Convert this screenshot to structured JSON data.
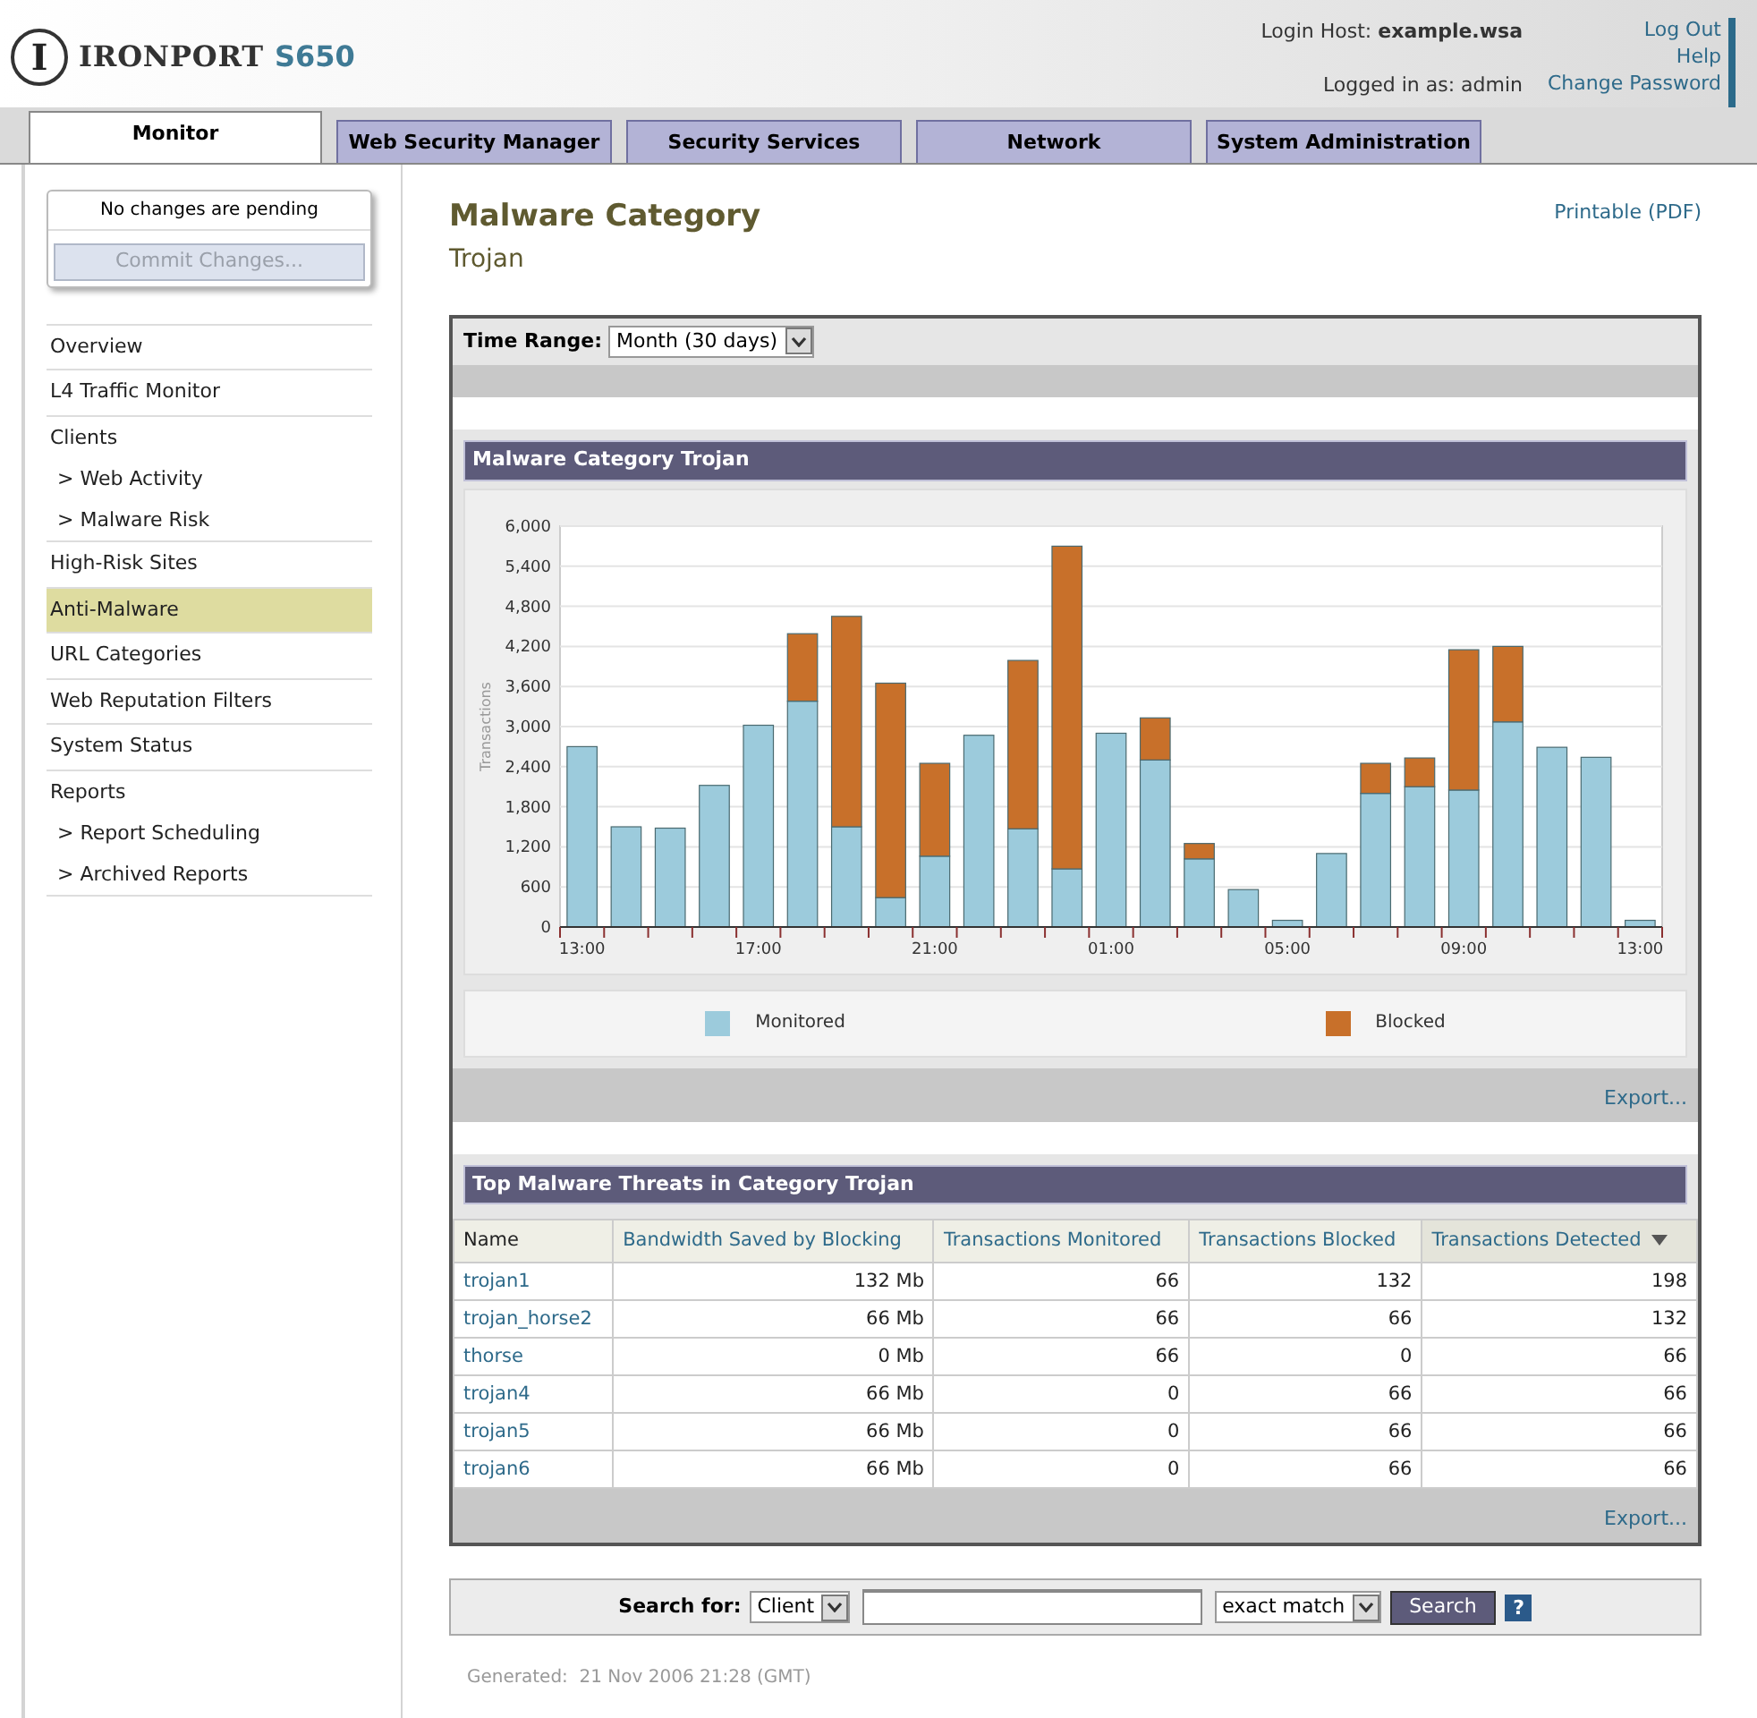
{
  "header": {
    "logo_mark": "I",
    "brand": "IRONPORT",
    "model": "S650",
    "login_host_label": "Login Host:",
    "login_host": "example.wsa",
    "logged_in": "Logged in as: admin",
    "links": [
      "Log Out",
      "Help",
      "Change Password"
    ]
  },
  "tabs": [
    {
      "label": "Monitor",
      "selected": true
    },
    {
      "label": "Web Security Manager",
      "selected": false
    },
    {
      "label": "Security Services",
      "selected": false
    },
    {
      "label": "Network",
      "selected": false
    },
    {
      "label": "System Administration",
      "selected": false
    }
  ],
  "sidebar": {
    "pending": {
      "status": "No changes are pending",
      "button": "Commit Changes...",
      "disabled": true
    },
    "items": [
      {
        "label": "Overview",
        "selected": false
      },
      {
        "label": "L4 Traffic Monitor",
        "selected": false
      },
      {
        "label": "Clients",
        "selected": false,
        "children": [
          {
            "label": "> Web Activity",
            "selected": false
          },
          {
            "label": "> Malware Risk",
            "selected": false
          }
        ]
      },
      {
        "label": "High-Risk Sites",
        "selected": false
      },
      {
        "label": "Anti-Malware",
        "selected": true
      },
      {
        "label": "URL Categories",
        "selected": false
      },
      {
        "label": "Web Reputation Filters",
        "selected": false
      },
      {
        "label": "System Status",
        "selected": false
      },
      {
        "label": "Reports",
        "selected": false,
        "children": [
          {
            "label": "> Report Scheduling",
            "selected": false
          },
          {
            "label": "> Archived Reports",
            "selected": false
          }
        ]
      }
    ]
  },
  "page": {
    "title": "Malware Category",
    "subtitle": "Trojan",
    "printable": "Printable (PDF)"
  },
  "time_range": {
    "label": "Time Range:",
    "value": "Month (30 days)"
  },
  "chart_panel": {
    "title": "Malware Category Trojan",
    "export": "Export...",
    "chart_data": {
      "type": "bar",
      "stacked": true,
      "grid": true,
      "ylabel": "Transactions",
      "categories": [
        "13:00",
        null,
        null,
        null,
        "17:00",
        null,
        null,
        null,
        "21:00",
        null,
        null,
        null,
        "01:00",
        null,
        null,
        null,
        "05:00",
        null,
        null,
        null,
        "09:00",
        null,
        null,
        null,
        "13:00"
      ],
      "ylim": [
        0,
        6000
      ],
      "yticks": [
        {
          "value": 0,
          "label": "0"
        },
        {
          "value": 600,
          "label": "600"
        },
        {
          "value": 1200,
          "label": "1,200"
        },
        {
          "value": 1800,
          "label": "1,800"
        },
        {
          "value": 2400,
          "label": "2,400"
        },
        {
          "value": 3000,
          "label": "3,000"
        },
        {
          "value": 3600,
          "label": "3,600"
        },
        {
          "value": 4200,
          "label": "4,200"
        },
        {
          "value": 4800,
          "label": "4,800"
        },
        {
          "value": 5400,
          "label": "5,400"
        },
        {
          "value": 6000,
          "label": "6,000"
        }
      ],
      "series": [
        {
          "name": "Monitored",
          "color": "#9ccbdc",
          "values": [
            2700,
            1500,
            1480,
            2120,
            3020,
            3380,
            1500,
            440,
            1060,
            2870,
            1470,
            870,
            2900,
            2500,
            1020,
            560,
            100,
            1100,
            2000,
            2100,
            2050,
            3070,
            2690,
            2540,
            100
          ]
        },
        {
          "name": "Blocked",
          "color": "#c8702a",
          "values": [
            0,
            0,
            0,
            0,
            0,
            1010,
            3150,
            3210,
            1390,
            0,
            2520,
            4830,
            0,
            630,
            230,
            0,
            0,
            0,
            450,
            430,
            2100,
            1130,
            0,
            0,
            0
          ]
        }
      ]
    }
  },
  "table": {
    "title": "Top Malware Threats in Category Trojan",
    "export": "Export...",
    "columns": [
      {
        "label": "Name",
        "sorted": false
      },
      {
        "label": "Bandwidth Saved by Blocking",
        "sorted": false
      },
      {
        "label": "Transactions Monitored",
        "sorted": false
      },
      {
        "label": "Transactions Blocked",
        "sorted": false
      },
      {
        "label": "Transactions Detected",
        "sorted": true
      }
    ],
    "rows": [
      [
        "trojan1",
        "132 Mb",
        "66",
        "132",
        "198"
      ],
      [
        "trojan_horse2",
        "66 Mb",
        "66",
        "66",
        "132"
      ],
      [
        "thorse",
        "0 Mb",
        "66",
        "0",
        "66"
      ],
      [
        "trojan4",
        "66 Mb",
        "0",
        "66",
        "66"
      ],
      [
        "trojan5",
        "66 Mb",
        "0",
        "66",
        "66"
      ],
      [
        "trojan6",
        "66 Mb",
        "0",
        "66",
        "66"
      ]
    ]
  },
  "search": {
    "label": "Search for:",
    "scope": "Client",
    "match": "exact match",
    "button": "Search",
    "help": "?"
  },
  "generated": "Generated:  21 Nov 2006 21:28 (GMT)"
}
